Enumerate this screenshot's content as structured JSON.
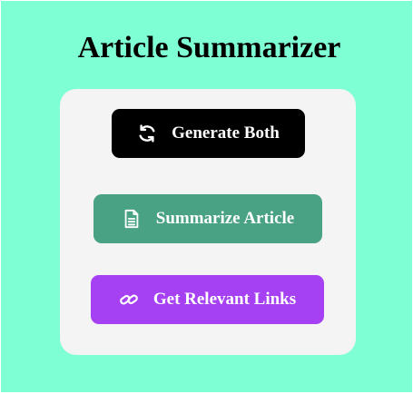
{
  "page": {
    "title": "Article Summarizer",
    "background_color": "#7fffd4",
    "card_color": "#f4f4f4"
  },
  "buttons": [
    {
      "id": "generate-both",
      "label": "Generate Both",
      "icon": "refresh-icon",
      "color": "#000000"
    },
    {
      "id": "summarize-article",
      "label": "Summarize Article",
      "icon": "document-icon",
      "color": "#48a283"
    },
    {
      "id": "get-relevant-links",
      "label": "Get Relevant Links",
      "icon": "link-icon",
      "color": "#a640f3"
    }
  ]
}
